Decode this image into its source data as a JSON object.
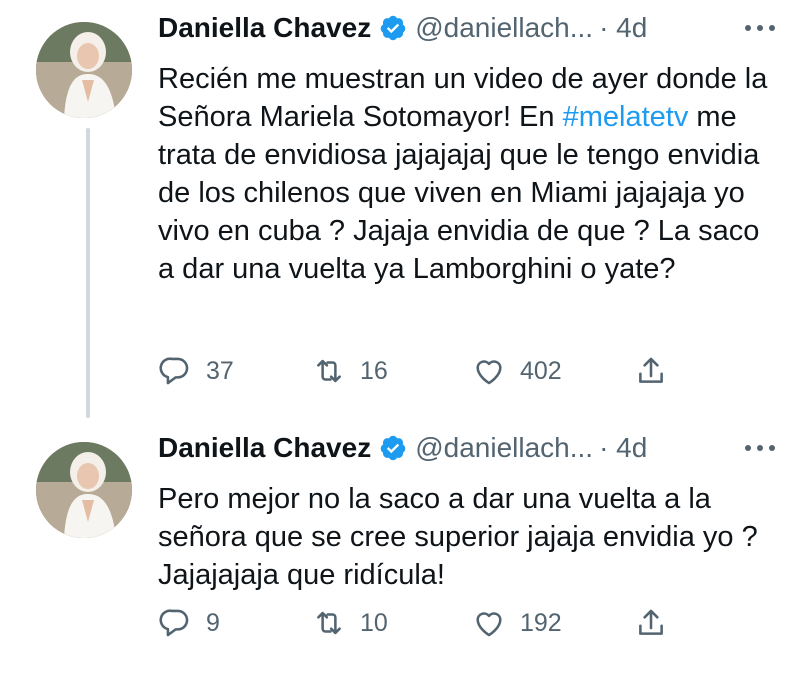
{
  "tweets": [
    {
      "display_name": "Daniella Chavez",
      "handle": "@daniellach...",
      "time": "· 4d",
      "text_before": "Recién me muestran un video de ayer donde la Señora Mariela Sotomayor! En ",
      "hashtag": "#melatetv",
      "text_after": " me trata de envidiosa jajajajaj que le tengo envidia de los chilenos que viven en Miami jajajaja yo vivo en cuba ? Jajaja envidia de que ? La saco a dar una vuelta ya Lamborghini o yate?",
      "replies": "37",
      "retweets": "16",
      "likes": "402"
    },
    {
      "display_name": "Daniella Chavez",
      "handle": "@daniellach...",
      "time": "· 4d",
      "text": "Pero mejor no la saco a dar una vuelta a la señora que se cree superior jajaja envidia yo ? Jajajajaja que ridícula!",
      "replies": "9",
      "retweets": "10",
      "likes": "192"
    }
  ],
  "icons": {
    "verified": "verified-badge-icon",
    "more": "more-horizontal-icon",
    "reply": "reply-icon",
    "retweet": "retweet-icon",
    "like": "heart-icon",
    "share": "share-icon"
  },
  "colors": {
    "text": "#0f1419",
    "secondary": "#536471",
    "accent": "#1d9bf0",
    "thread_line": "#cfd9de"
  }
}
